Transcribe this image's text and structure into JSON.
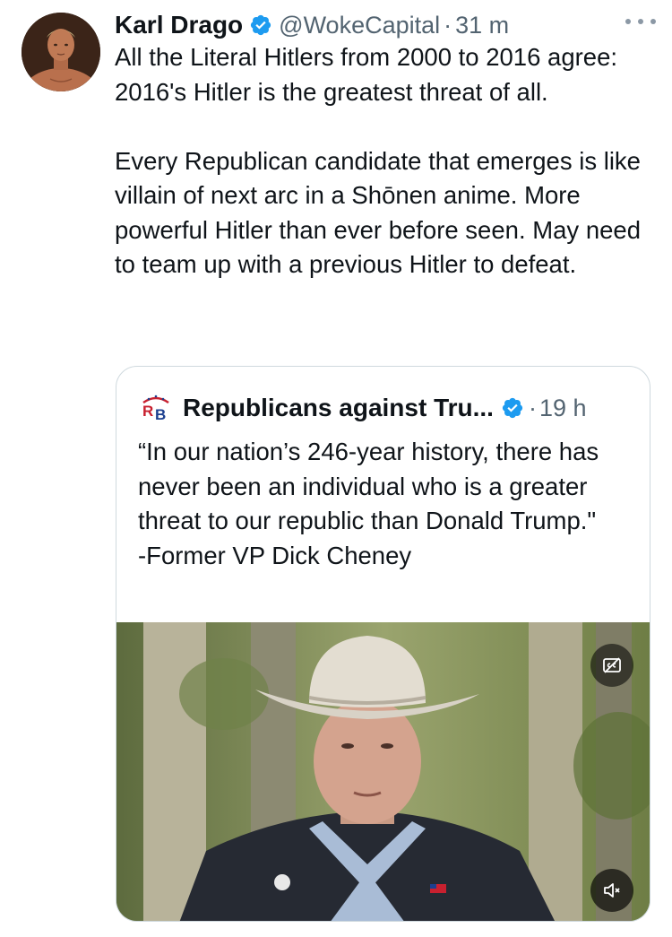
{
  "tweet": {
    "author": {
      "name": "Karl Drago",
      "handle": "@WokeCapital",
      "time": "31 m",
      "verified": true
    },
    "text": "All the Literal Hitlers from 2000 to 2016 agree: 2016's Hitler is the greatest threat of all.\n\nEvery Republican candidate that emerges is like villain of next arc in a Shōnen anime. More powerful Hitler than ever before seen. May need to team up with a previous Hitler to defeat."
  },
  "quoted_tweet": {
    "author": {
      "name": "Republicans against Tru...",
      "time": "19 h",
      "verified": true,
      "avatar_initials": "RB"
    },
    "text": "“In our nation’s 246-year history, there has never been an individual who is a greater threat to our republic than Donald Trump.\"\n-Former VP Dick Cheney",
    "media": {
      "type": "video",
      "controls": [
        "captions-toggle-icon",
        "mute-icon"
      ]
    }
  },
  "separator_dot": "·",
  "colors": {
    "verified_blue": "#1d9bf0",
    "text_primary": "#0f1419",
    "text_secondary": "#536471",
    "border": "#cfd9de"
  }
}
